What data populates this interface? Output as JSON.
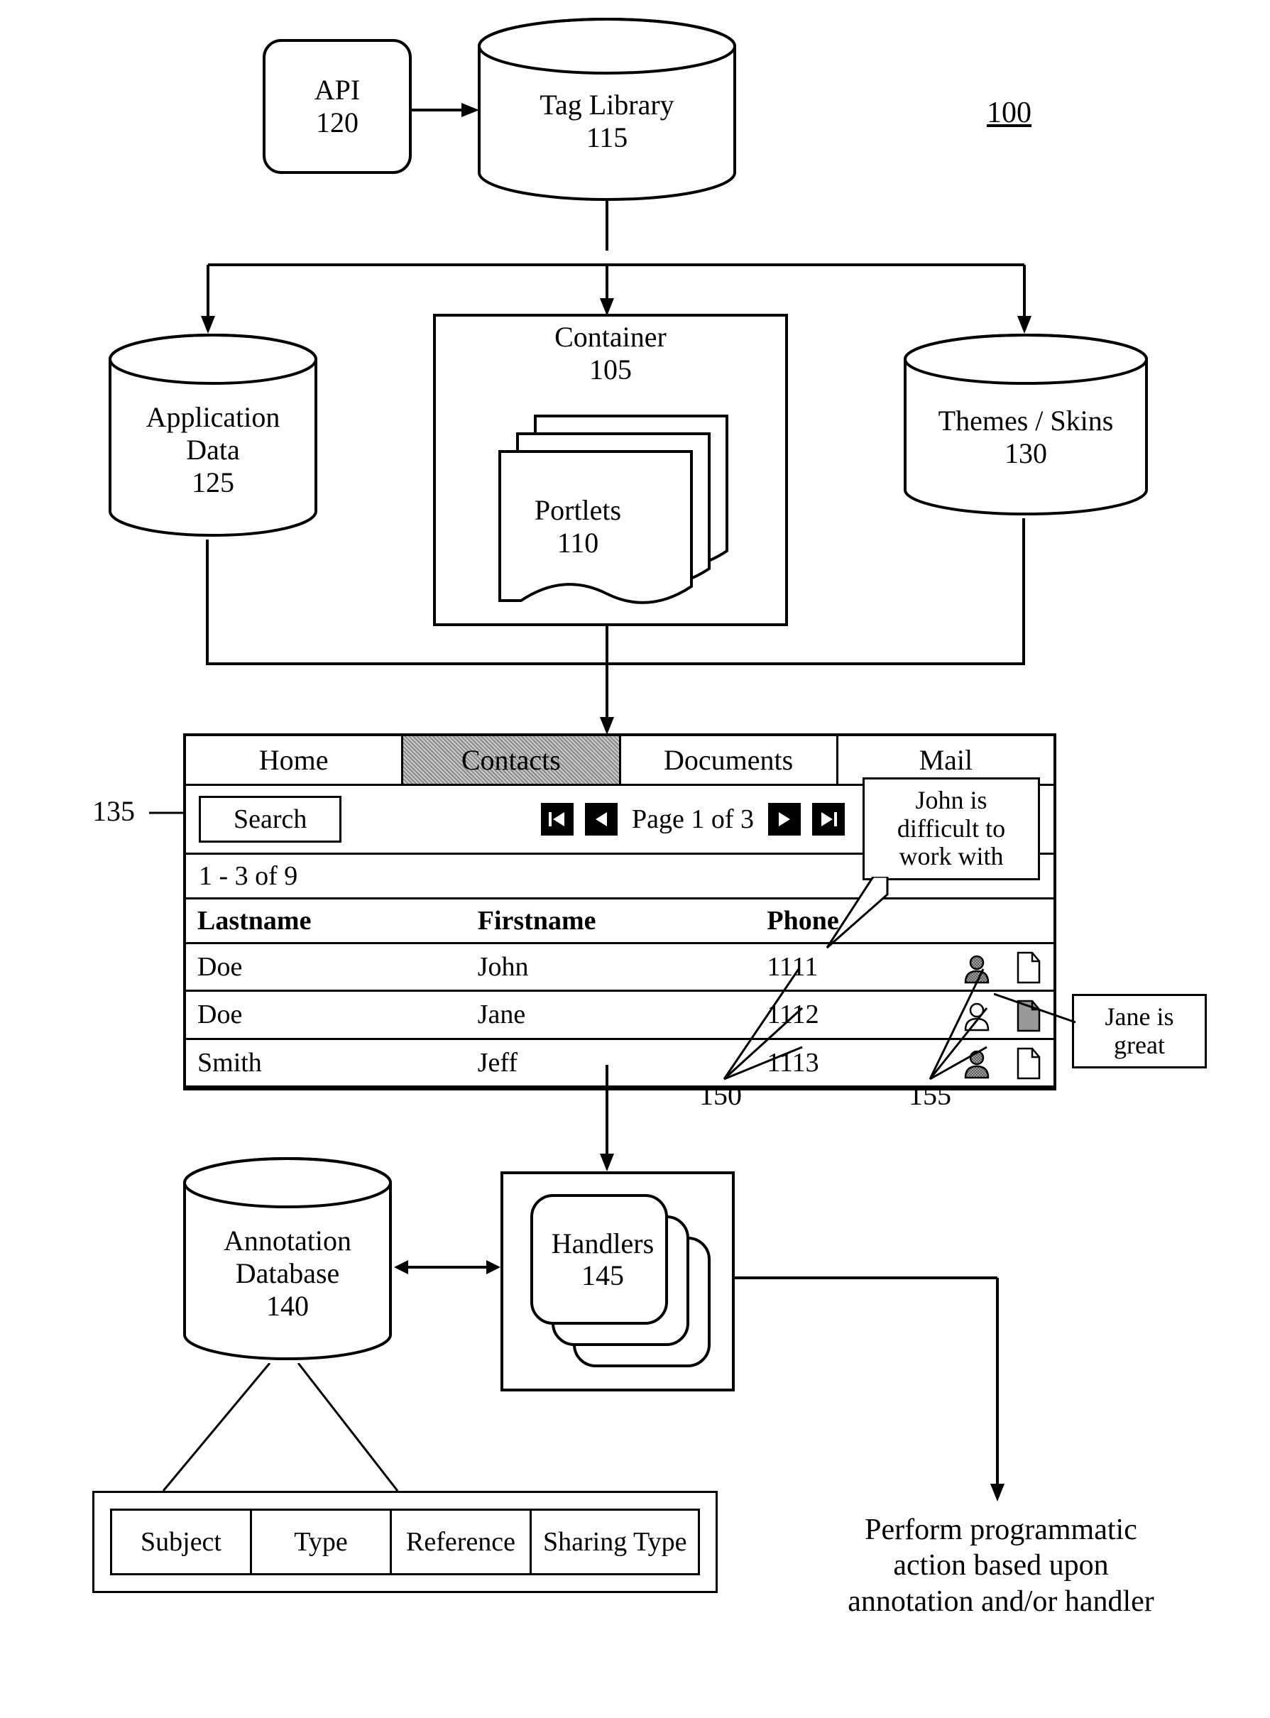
{
  "figure_ref": "100",
  "api": {
    "label": "API",
    "num": "120"
  },
  "tag_library": {
    "label": "Tag Library",
    "num": "115"
  },
  "application_data": {
    "label1": "Application",
    "label2": "Data",
    "num": "125"
  },
  "themes_skins": {
    "label": "Themes / Skins",
    "num": "130"
  },
  "container": {
    "label": "Container",
    "num": "105"
  },
  "portlets": {
    "label": "Portlets",
    "num": "110"
  },
  "portal_ref": "135",
  "portal": {
    "tabs": [
      "Home",
      "Contacts",
      "Documents",
      "Mail"
    ],
    "active_tab_index": 1,
    "search_label": "Search",
    "page_text": "Page 1 of 3",
    "count_text": "1 - 3 of 9",
    "columns": [
      "Lastname",
      "Firstname",
      "Phone"
    ],
    "rows": [
      {
        "last": "Doe",
        "first": "John",
        "phone": "1111",
        "person_shaded": true,
        "doc_shaded": false
      },
      {
        "last": "Doe",
        "first": "Jane",
        "phone": "1112",
        "person_shaded": false,
        "doc_shaded": true
      },
      {
        "last": "Smith",
        "first": "Jeff",
        "phone": "1113",
        "person_shaded": true,
        "doc_shaded": false
      }
    ]
  },
  "callout_john": "John is difficult to work with",
  "callout_jane": "Jane is great",
  "person_col_ref": "150",
  "doc_col_ref": "155",
  "annotation_db": {
    "label1": "Annotation",
    "label2": "Database",
    "num": "140"
  },
  "handlers": {
    "label": "Handlers",
    "num": "145"
  },
  "schema": [
    "Subject",
    "Type",
    "Reference",
    "Sharing Type"
  ],
  "action_text_l1": "Perform programmatic",
  "action_text_l2": "action based upon",
  "action_text_l3": "annotation and/or handler"
}
